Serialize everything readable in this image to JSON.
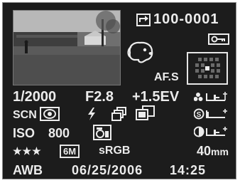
{
  "file_number": "100-0001",
  "af_mode": "AF.S",
  "shutter_speed": "1/2000",
  "aperture": "F2.8",
  "exposure_comp": "+1.5EV",
  "scene_label": "SCN",
  "iso_label": "ISO",
  "iso_value": "800",
  "quality_stars": "★★★",
  "resolution": "6M",
  "color_space": "sRGB",
  "focal_length": "40",
  "focal_unit": "mm",
  "white_balance": "AWB",
  "date": "06/25/2006",
  "time": "14:25",
  "icons": {
    "rotate": "rotate-icon",
    "protect": "protect-key-icon",
    "scene": "pet-dog-icon",
    "metering": "multi-segment-metering-icon",
    "flash": "flash-icon",
    "drive_continuous": "continuous-shooting-icon",
    "drive_bracket": "bracket-icon",
    "digital_filter": "digital-filter-icon",
    "sharpness": "sharpness-icon",
    "saturation": "saturation-icon",
    "contrast": "contrast-icon"
  },
  "colors": {
    "background": "#1c1c1c",
    "text": "#ececec"
  }
}
